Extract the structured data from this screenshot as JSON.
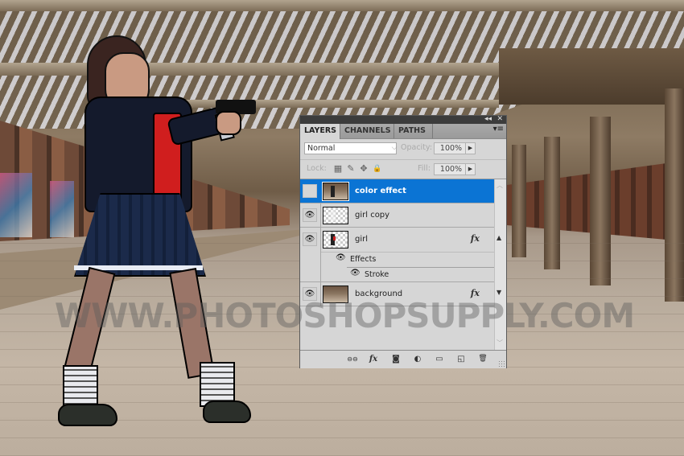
{
  "scene": {
    "description": "Abandoned train station background with comic-style girl holding a pistol",
    "watermark": "WWW.PHOTOSHOPSUPPLY.COM"
  },
  "panel": {
    "titlebar": {
      "collapse_icon": "double-chevron-left-icon",
      "close_icon": "close-icon",
      "collapse_glyph": "◂◂",
      "close_glyph": "✕"
    },
    "tabs": [
      {
        "label": "LAYERS",
        "active": true
      },
      {
        "label": "CHANNELS",
        "active": false
      },
      {
        "label": "PATHS",
        "active": false
      }
    ],
    "menu_glyph": "▾≡",
    "blend_mode": "Normal",
    "blend_arrow": "⌵",
    "opacity_label": "Opacity:",
    "opacity_value": "100%",
    "lock_label": "Lock:",
    "fill_label": "Fill:",
    "fill_value": "100%",
    "step_glyph": "▶",
    "lock_icons": [
      {
        "name": "lock-transparent-pixels-icon",
        "glyph": "▦"
      },
      {
        "name": "lock-image-pixels-icon",
        "glyph": "✎"
      },
      {
        "name": "lock-position-icon",
        "glyph": "✥"
      },
      {
        "name": "lock-all-icon",
        "glyph": "🔒"
      }
    ],
    "layers": [
      {
        "name": "color effect",
        "visible": false,
        "selected": true,
        "thumb": "photo",
        "fx": false
      },
      {
        "name": "girl copy",
        "visible": true,
        "selected": false,
        "thumb": "transparent",
        "fx": false
      },
      {
        "name": "girl",
        "visible": true,
        "selected": false,
        "thumb": "transparent",
        "fx": true,
        "effects_label": "Effects",
        "effects": [
          "Stroke"
        ]
      },
      {
        "name": "background",
        "visible": true,
        "selected": false,
        "thumb": "photo",
        "fx": true
      }
    ],
    "fx_glyph": "fx",
    "eye_glyph": "👁",
    "bottom_icons": [
      {
        "name": "link-layers-icon",
        "glyph": "⊖⊖"
      },
      {
        "name": "add-layer-style-icon",
        "glyph": "fx"
      },
      {
        "name": "add-layer-mask-icon",
        "glyph": "◙"
      },
      {
        "name": "new-adjustment-layer-icon",
        "glyph": "◐"
      },
      {
        "name": "new-group-icon",
        "glyph": "▭"
      },
      {
        "name": "new-layer-icon",
        "glyph": "◱"
      },
      {
        "name": "delete-layer-icon",
        "glyph": "🗑"
      }
    ],
    "scroll_up": "︿",
    "scroll_down": "﹀",
    "layer_up_arrow": "▲",
    "layer_down_arrow": "▼"
  }
}
